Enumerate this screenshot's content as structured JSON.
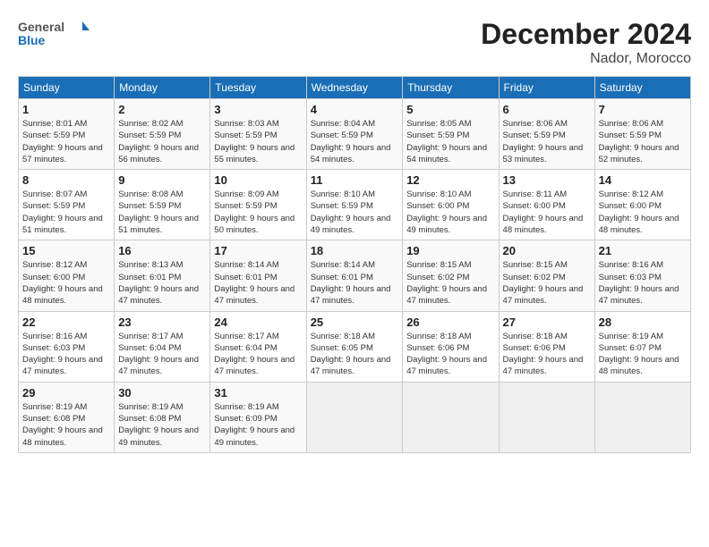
{
  "header": {
    "logo_general": "General",
    "logo_blue": "Blue",
    "month_title": "December 2024",
    "location": "Nador, Morocco"
  },
  "weekdays": [
    "Sunday",
    "Monday",
    "Tuesday",
    "Wednesday",
    "Thursday",
    "Friday",
    "Saturday"
  ],
  "weeks": [
    [
      {
        "day": "1",
        "sunrise": "8:01 AM",
        "sunset": "5:59 PM",
        "daylight": "9 hours and 57 minutes."
      },
      {
        "day": "2",
        "sunrise": "8:02 AM",
        "sunset": "5:59 PM",
        "daylight": "9 hours and 56 minutes."
      },
      {
        "day": "3",
        "sunrise": "8:03 AM",
        "sunset": "5:59 PM",
        "daylight": "9 hours and 55 minutes."
      },
      {
        "day": "4",
        "sunrise": "8:04 AM",
        "sunset": "5:59 PM",
        "daylight": "9 hours and 54 minutes."
      },
      {
        "day": "5",
        "sunrise": "8:05 AM",
        "sunset": "5:59 PM",
        "daylight": "9 hours and 54 minutes."
      },
      {
        "day": "6",
        "sunrise": "8:06 AM",
        "sunset": "5:59 PM",
        "daylight": "9 hours and 53 minutes."
      },
      {
        "day": "7",
        "sunrise": "8:06 AM",
        "sunset": "5:59 PM",
        "daylight": "9 hours and 52 minutes."
      }
    ],
    [
      {
        "day": "8",
        "sunrise": "8:07 AM",
        "sunset": "5:59 PM",
        "daylight": "9 hours and 51 minutes."
      },
      {
        "day": "9",
        "sunrise": "8:08 AM",
        "sunset": "5:59 PM",
        "daylight": "9 hours and 51 minutes."
      },
      {
        "day": "10",
        "sunrise": "8:09 AM",
        "sunset": "5:59 PM",
        "daylight": "9 hours and 50 minutes."
      },
      {
        "day": "11",
        "sunrise": "8:10 AM",
        "sunset": "5:59 PM",
        "daylight": "9 hours and 49 minutes."
      },
      {
        "day": "12",
        "sunrise": "8:10 AM",
        "sunset": "6:00 PM",
        "daylight": "9 hours and 49 minutes."
      },
      {
        "day": "13",
        "sunrise": "8:11 AM",
        "sunset": "6:00 PM",
        "daylight": "9 hours and 48 minutes."
      },
      {
        "day": "14",
        "sunrise": "8:12 AM",
        "sunset": "6:00 PM",
        "daylight": "9 hours and 48 minutes."
      }
    ],
    [
      {
        "day": "15",
        "sunrise": "8:12 AM",
        "sunset": "6:00 PM",
        "daylight": "9 hours and 48 minutes."
      },
      {
        "day": "16",
        "sunrise": "8:13 AM",
        "sunset": "6:01 PM",
        "daylight": "9 hours and 47 minutes."
      },
      {
        "day": "17",
        "sunrise": "8:14 AM",
        "sunset": "6:01 PM",
        "daylight": "9 hours and 47 minutes."
      },
      {
        "day": "18",
        "sunrise": "8:14 AM",
        "sunset": "6:01 PM",
        "daylight": "9 hours and 47 minutes."
      },
      {
        "day": "19",
        "sunrise": "8:15 AM",
        "sunset": "6:02 PM",
        "daylight": "9 hours and 47 minutes."
      },
      {
        "day": "20",
        "sunrise": "8:15 AM",
        "sunset": "6:02 PM",
        "daylight": "9 hours and 47 minutes."
      },
      {
        "day": "21",
        "sunrise": "8:16 AM",
        "sunset": "6:03 PM",
        "daylight": "9 hours and 47 minutes."
      }
    ],
    [
      {
        "day": "22",
        "sunrise": "8:16 AM",
        "sunset": "6:03 PM",
        "daylight": "9 hours and 47 minutes."
      },
      {
        "day": "23",
        "sunrise": "8:17 AM",
        "sunset": "6:04 PM",
        "daylight": "9 hours and 47 minutes."
      },
      {
        "day": "24",
        "sunrise": "8:17 AM",
        "sunset": "6:04 PM",
        "daylight": "9 hours and 47 minutes."
      },
      {
        "day": "25",
        "sunrise": "8:18 AM",
        "sunset": "6:05 PM",
        "daylight": "9 hours and 47 minutes."
      },
      {
        "day": "26",
        "sunrise": "8:18 AM",
        "sunset": "6:06 PM",
        "daylight": "9 hours and 47 minutes."
      },
      {
        "day": "27",
        "sunrise": "8:18 AM",
        "sunset": "6:06 PM",
        "daylight": "9 hours and 47 minutes."
      },
      {
        "day": "28",
        "sunrise": "8:19 AM",
        "sunset": "6:07 PM",
        "daylight": "9 hours and 48 minutes."
      }
    ],
    [
      {
        "day": "29",
        "sunrise": "8:19 AM",
        "sunset": "6:08 PM",
        "daylight": "9 hours and 48 minutes."
      },
      {
        "day": "30",
        "sunrise": "8:19 AM",
        "sunset": "6:08 PM",
        "daylight": "9 hours and 49 minutes."
      },
      {
        "day": "31",
        "sunrise": "8:19 AM",
        "sunset": "6:09 PM",
        "daylight": "9 hours and 49 minutes."
      },
      null,
      null,
      null,
      null
    ]
  ]
}
